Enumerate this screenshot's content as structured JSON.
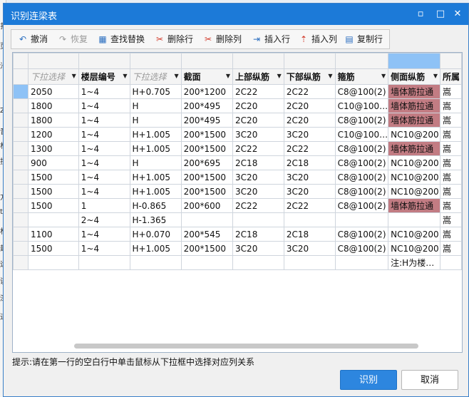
{
  "background_strip": [
    "扌",
    "页",
    "沿",
    "Z",
    "音",
    "林",
    "扶",
    "方",
    "t",
    "林",
    "封",
    "运",
    "谨",
    "深",
    "道"
  ],
  "dialog": {
    "title": "识别连梁表",
    "close_glyph": "✕",
    "minimize_glyph": "▫",
    "maximize_glyph": "□"
  },
  "toolbar": {
    "undo": "撤消",
    "redo": "恢复",
    "find_replace": "查找替换",
    "delete_row": "删除行",
    "delete_col": "删除列",
    "insert_row": "插入行",
    "insert_col": "插入列",
    "copy_row": "复制行"
  },
  "icons": {
    "undo": "↶",
    "redo": "↷",
    "find": "▦",
    "delete_row": "✂",
    "delete_col": "✂",
    "insert_row": "⇥",
    "insert_col": "⇡",
    "copy": "▤"
  },
  "table": {
    "headers": [
      "下拉选择",
      "楼层编号",
      "下拉选择",
      "截面",
      "上部纵筋",
      "下部纵筋",
      "箍筋",
      "侧面纵筋",
      "所属"
    ],
    "rows": [
      [
        "2050",
        "1~4",
        "H+0.705",
        "200*1200",
        "2C22",
        "2C22",
        "C8@100(2)",
        "墙体筋拉通",
        "嵩"
      ],
      [
        "1800",
        "1~4",
        "H",
        "200*495",
        "2C20",
        "2C20",
        "C10@100…",
        "墙体筋拉通",
        "嵩"
      ],
      [
        "1800",
        "1~4",
        "H",
        "200*495",
        "2C20",
        "2C20",
        "C8@100(2)",
        "墙体筋拉通",
        "嵩"
      ],
      [
        "1200",
        "1~4",
        "H+1.005",
        "200*1500",
        "3C20",
        "3C20",
        "C10@100…",
        "NC10@200",
        "嵩"
      ],
      [
        "1300",
        "1~4",
        "H+1.005",
        "200*1500",
        "2C22",
        "2C22",
        "C8@100(2)",
        "墙体筋拉通",
        "嵩"
      ],
      [
        "900",
        "1~4",
        "H",
        "200*695",
        "2C18",
        "2C18",
        "C8@100(2)",
        "NC10@200",
        "嵩"
      ],
      [
        "1500",
        "1~4",
        "H+1.005",
        "200*1500",
        "3C20",
        "3C20",
        "C8@100(2)",
        "NC10@200",
        "嵩"
      ],
      [
        "1500",
        "1~4",
        "H+1.005",
        "200*1500",
        "3C20",
        "3C20",
        "C8@100(2)",
        "NC10@200",
        "嵩"
      ],
      [
        "1500",
        "1",
        "H-0.865",
        "200*600",
        "2C22",
        "2C22",
        "C8@100(2)",
        "墙体筋拉通",
        "嵩"
      ],
      [
        "",
        "2~4",
        "H-1.365",
        "",
        "",
        "",
        "",
        "",
        "嵩"
      ],
      [
        "1100",
        "1~4",
        "H+0.070",
        "200*545",
        "2C18",
        "2C18",
        "C8@100(2)",
        "NC10@200",
        "嵩"
      ],
      [
        "1500",
        "1~4",
        "H+1.005",
        "200*1500",
        "3C20",
        "3C20",
        "C8@100(2)",
        "NC10@200",
        "嵩"
      ],
      [
        "",
        "",
        "",
        "",
        "",
        "",
        "",
        "注:H为楼…",
        ""
      ]
    ]
  },
  "highlight_color": "#c27c83",
  "hint": "提示:请在第一行的空白行中单击鼠标从下拉框中选择对应列关系",
  "buttons": {
    "ok": "识别",
    "cancel": "取消"
  }
}
